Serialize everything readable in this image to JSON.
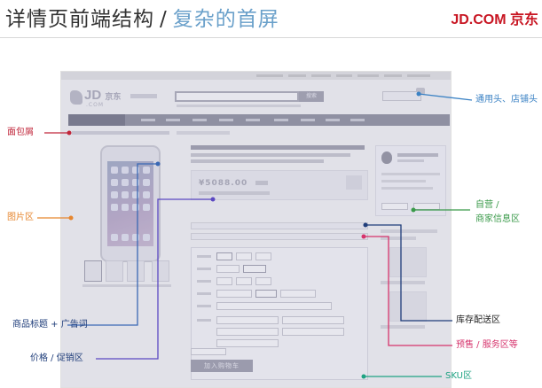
{
  "slide": {
    "title_main": "详情页前端结构",
    "title_sep": "/",
    "title_sub": "复杂的首屏",
    "brand": "JD.COM 京东"
  },
  "mock": {
    "logo": "JD",
    "logo_cn": "京东",
    "logo_com": ".COM",
    "search_btn": "搜索",
    "price": "¥5088.00",
    "add_to_cart": "加入购物车"
  },
  "annotations": {
    "header": "通用头、店铺头",
    "breadcrumb": "面包屑",
    "gallery": "图片区",
    "seller": "自营 /",
    "seller2": "商家信息区",
    "title_ad": "商品标题 + 广告词",
    "stock": "库存配送区",
    "presale": "预售 / 服务区等",
    "price": "价格 / 促销区",
    "sku": "SKU区"
  },
  "colors": {
    "header": "#3b82c4",
    "breadcrumb": "#c0263a",
    "gallery": "#e6862e",
    "seller": "#3a9a4a",
    "title_ad": "#3a68b4",
    "stock": "#1f3d7a",
    "presale": "#d6336c",
    "price": "#5b48c2",
    "sku": "#1fa383"
  }
}
